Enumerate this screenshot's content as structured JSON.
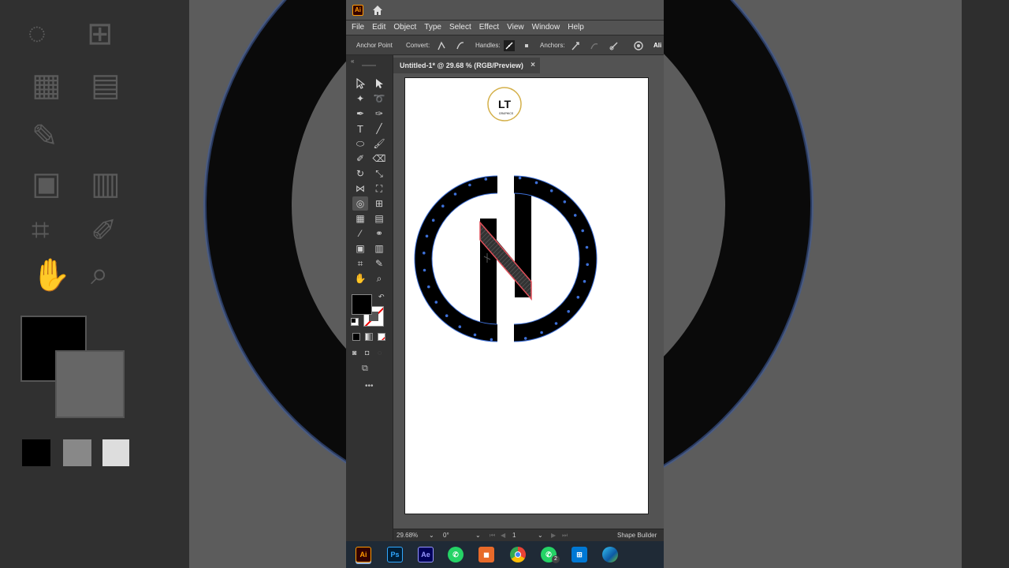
{
  "app": {
    "logo": "Ai",
    "icons": {
      "home": "home-icon"
    }
  },
  "menu": [
    "File",
    "Edit",
    "Object",
    "Type",
    "Select",
    "Effect",
    "View",
    "Window",
    "Help"
  ],
  "control_bar": {
    "anchor_point": "Anchor Point",
    "convert": "Convert:",
    "handles": "Handles:",
    "anchors": "Anchors:",
    "align": "Ali"
  },
  "document": {
    "tab_title": "Untitled-1* @ 29.68 % (RGB/Preview)",
    "close": "×"
  },
  "watermark": {
    "letters": "LT",
    "sub": "GRAPHICS"
  },
  "status": {
    "zoom": "29.68%",
    "rotation": "0°",
    "artboard": "1",
    "tool": "Shape Builder"
  },
  "colors": {
    "ui_dark": "#323232",
    "ui_mid": "#535353",
    "selection": "#3d6fd6",
    "highlight": "#e0505a",
    "fill": "#000000"
  },
  "taskbar": [
    {
      "label": "Ai",
      "name": "illustrator"
    },
    {
      "label": "Ps",
      "name": "photoshop"
    },
    {
      "label": "Ae",
      "name": "after-effects"
    },
    {
      "label": "",
      "name": "whatsapp-business"
    },
    {
      "label": "",
      "name": "files"
    },
    {
      "label": "",
      "name": "chrome"
    },
    {
      "label": "2",
      "name": "whatsapp"
    },
    {
      "label": "",
      "name": "store"
    },
    {
      "label": "",
      "name": "edge"
    }
  ]
}
